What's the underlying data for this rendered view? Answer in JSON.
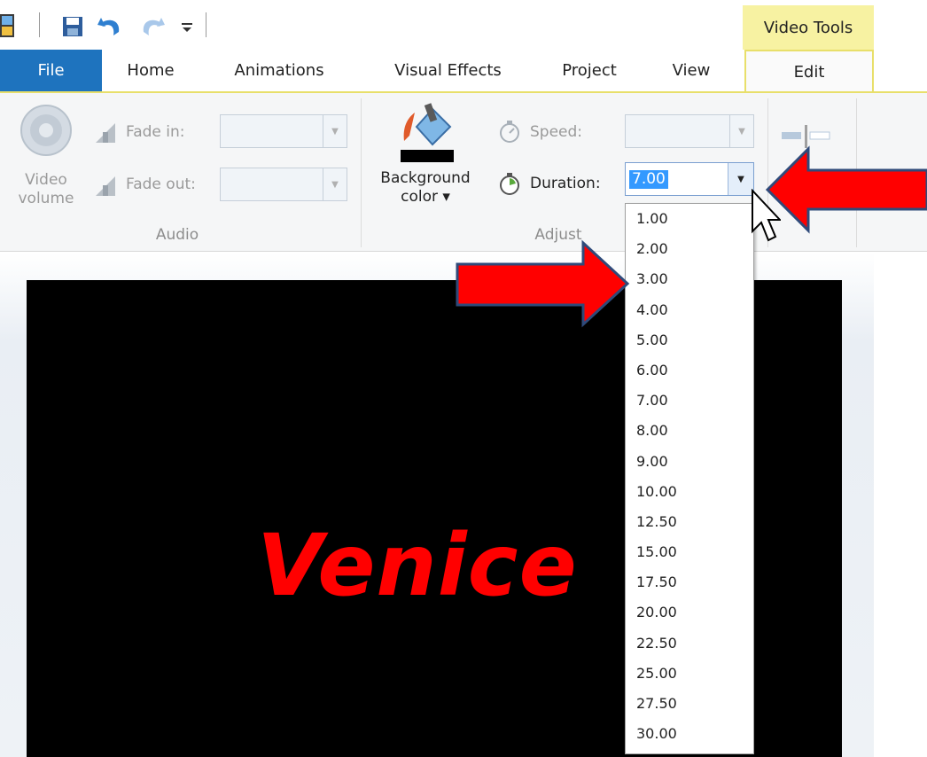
{
  "qat": {
    "icons": [
      "movie-app-icon",
      "save-icon",
      "undo-icon",
      "redo-icon",
      "customize-qat-icon"
    ]
  },
  "contextual_tab": {
    "label": "Video Tools"
  },
  "tabs": [
    {
      "label": "File"
    },
    {
      "label": "Home"
    },
    {
      "label": "Animations"
    },
    {
      "label": "Visual Effects"
    },
    {
      "label": "Project"
    },
    {
      "label": "View"
    },
    {
      "label": "Edit",
      "active": true
    }
  ],
  "ribbon": {
    "audio": {
      "group_label": "Audio",
      "video_volume_label_1": "Video",
      "video_volume_label_2": "volume",
      "fade_in_label": "Fade in:",
      "fade_out_label": "Fade out:"
    },
    "adjust": {
      "group_label": "Adjust",
      "background_color_label_1": "Background",
      "background_color_label_2": "color ▾",
      "speed_label": "Speed:",
      "duration_label": "Duration:",
      "duration_value": "7.00"
    }
  },
  "duration_options": [
    "1.00",
    "2.00",
    "3.00",
    "4.00",
    "5.00",
    "6.00",
    "7.00",
    "8.00",
    "9.00",
    "10.00",
    "12.50",
    "15.00",
    "17.50",
    "20.00",
    "22.50",
    "25.00",
    "27.50",
    "30.00"
  ],
  "preview": {
    "title_text": "Venice"
  },
  "colors": {
    "accent_blue": "#1e73be",
    "contextual_yellow": "#f7f2a2",
    "title_red": "#ff0000",
    "arrow_red": "#ff0000"
  }
}
